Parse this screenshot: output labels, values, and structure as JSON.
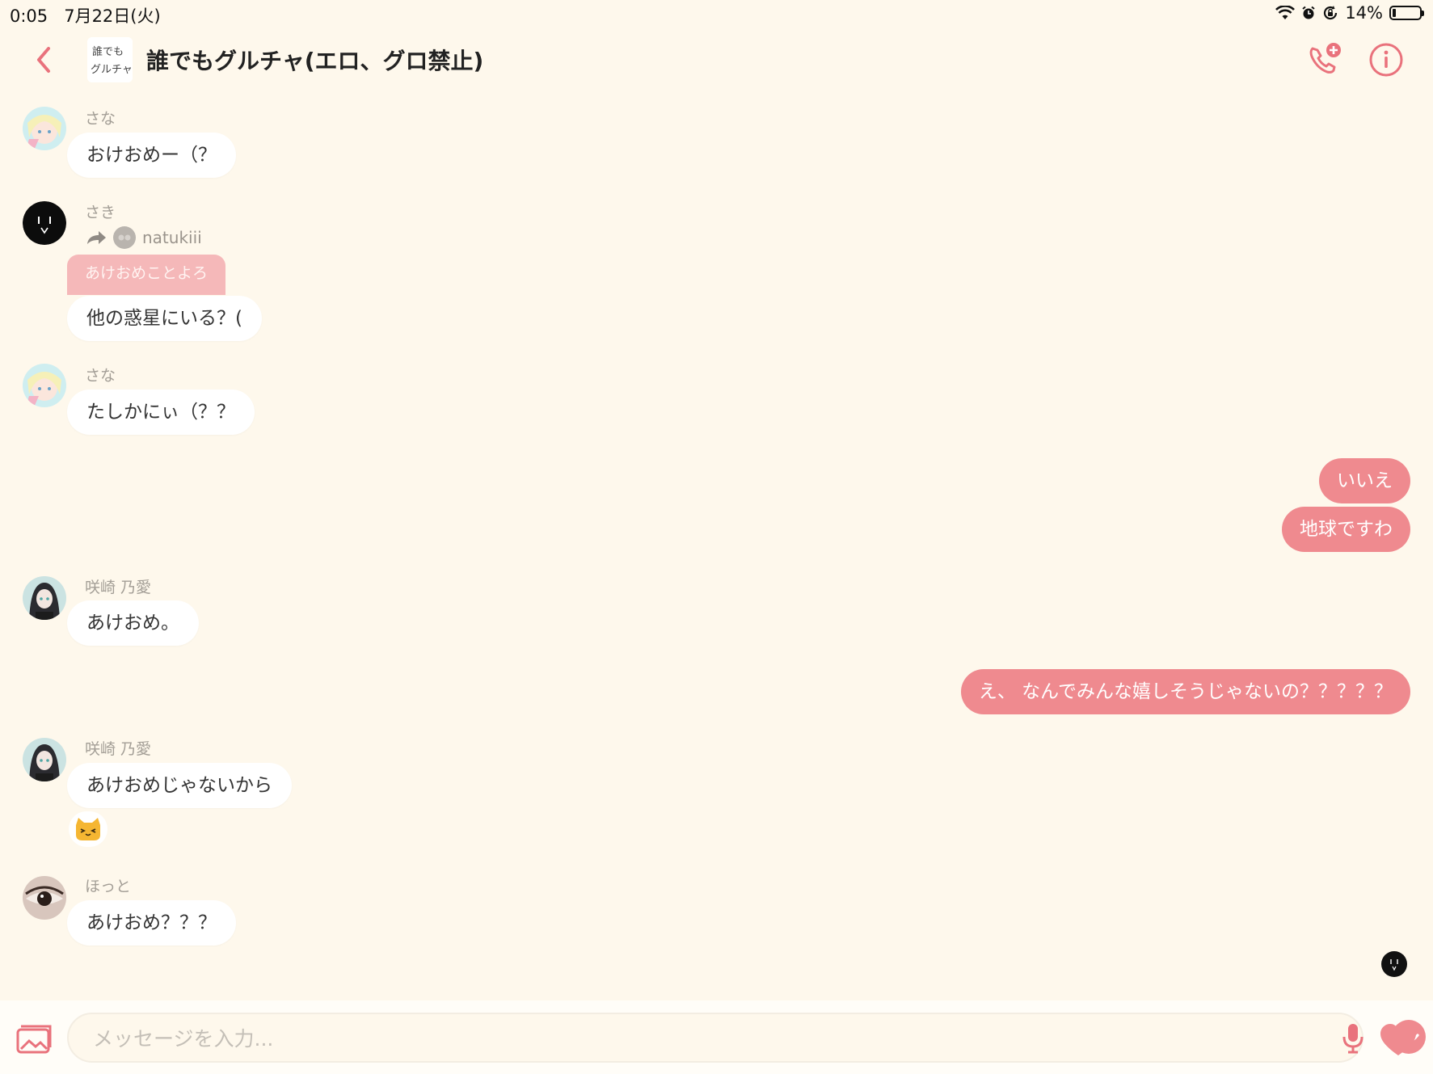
{
  "status_bar": {
    "time": "0:05",
    "date": "7月22日(火)",
    "battery": "14%",
    "battery_level": 0.14
  },
  "header": {
    "title": "誰でもグルチャ(エロ、グロ禁止)",
    "group_avatar_text": "誰でも グルチャ",
    "back_icon": "chevron-left-icon",
    "call_icon": "phone-plus-icon",
    "info_icon": "info-circle-icon",
    "accent_color": "#e9727c"
  },
  "messages": [
    {
      "sender": "さな",
      "text": "おけおめー（？"
    },
    {
      "sender": "さき",
      "forwarded_from": "natukiii",
      "quoted_text": "あけおめことよろ",
      "text": "他の惑星にいる？("
    },
    {
      "sender": "さな",
      "text": "たしかにぃ（？？"
    },
    {
      "outgoing": true,
      "text": "いいえ"
    },
    {
      "outgoing": true,
      "text": "地球ですわ"
    },
    {
      "sender": "咲崎 乃愛",
      "text": "あけおめ。"
    },
    {
      "outgoing": true,
      "text": "え、 なんでみんな嬉しそうじゃないの？？？？？"
    },
    {
      "sender": "咲崎 乃愛",
      "text": "あけおめじゃないから",
      "reaction": "cat-face-icon"
    },
    {
      "sender": "ほっと",
      "text": "あけおめ？？？"
    }
  ],
  "composer": {
    "placeholder": "メッセージを入力...",
    "photo_icon": "image-icon",
    "mic_icon": "microphone-icon",
    "emoji_icon": "smile-icon",
    "like_icon": "heart-icon"
  },
  "colors": {
    "background": "#fef8ec",
    "outgoing_bubble": "#ef8a8f",
    "quote_bubble": "#f5b8b9",
    "name_text": "#a39e96"
  }
}
